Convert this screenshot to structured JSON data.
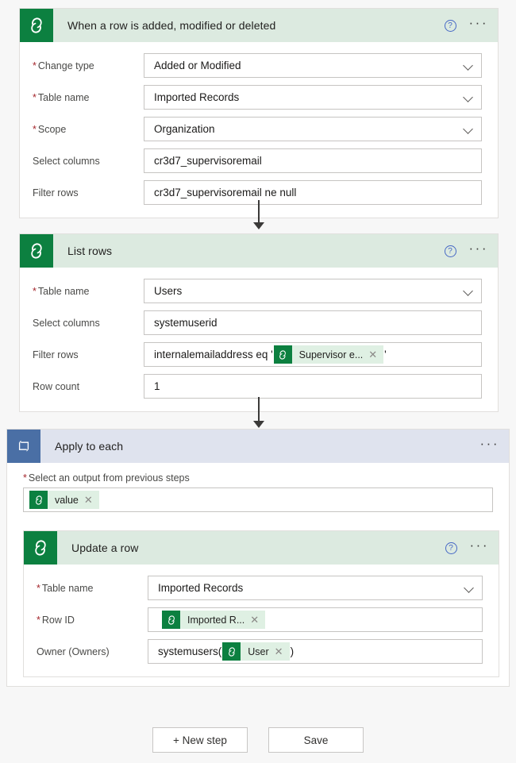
{
  "app": {
    "background_color": "#f7f7f7",
    "connector_green": "#0c8040",
    "loop_blue": "#4a6fa5",
    "card_header_green": "#dceae0",
    "card_header_blue": "#dfe3ee",
    "required_marker": "*",
    "help_glyph": "?",
    "ellipsis_glyph": "···",
    "token_close_glyph": "✕"
  },
  "steps": [
    {
      "id": "trigger",
      "title": "When a row is added, modified or deleted",
      "icon": "dataverse-icon",
      "help_label": "?",
      "more_label": "···",
      "fields": [
        {
          "label": "Change type",
          "required": true,
          "type": "dropdown",
          "value": "Added or Modified"
        },
        {
          "label": "Table name",
          "required": true,
          "type": "dropdown",
          "value": "Imported Records"
        },
        {
          "label": "Scope",
          "required": true,
          "type": "dropdown",
          "value": "Organization"
        },
        {
          "label": "Select columns",
          "required": false,
          "type": "text",
          "value": "cr3d7_supervisoremail"
        },
        {
          "label": "Filter rows",
          "required": false,
          "type": "text",
          "value": "cr3d7_supervisoremail ne null"
        }
      ]
    },
    {
      "id": "list-rows",
      "title": "List rows",
      "icon": "dataverse-icon",
      "help_label": "?",
      "more_label": "···",
      "fields": [
        {
          "label": "Table name",
          "required": true,
          "type": "dropdown",
          "value": "Users"
        },
        {
          "label": "Select columns",
          "required": false,
          "type": "text",
          "value": "systemuserid"
        },
        {
          "label": "Filter rows",
          "required": false,
          "type": "token",
          "prefix": "internalemailaddress eq '",
          "token": "Supervisor e...",
          "suffix": "'"
        },
        {
          "label": "Row count",
          "required": false,
          "type": "text",
          "value": "1"
        }
      ]
    }
  ],
  "loop": {
    "title": "Apply to each",
    "icon": "loop-icon",
    "more_label": "···",
    "output_field": {
      "label": "Select an output from previous steps",
      "required": true,
      "token": "value"
    },
    "inner_step": {
      "id": "update-row",
      "title": "Update a row",
      "icon": "dataverse-icon",
      "help_label": "?",
      "more_label": "···",
      "fields": [
        {
          "label": "Table name",
          "required": true,
          "type": "dropdown",
          "value": "Imported Records"
        },
        {
          "label": "Row ID",
          "required": true,
          "type": "token",
          "prefix": "",
          "token": "Imported R...",
          "suffix": ""
        },
        {
          "label": "Owner (Owners)",
          "required": false,
          "type": "token",
          "prefix": "systemusers(",
          "token": "User",
          "suffix": ")"
        }
      ]
    }
  },
  "footer": {
    "new_step_label": "+ New step",
    "save_label": "Save"
  }
}
